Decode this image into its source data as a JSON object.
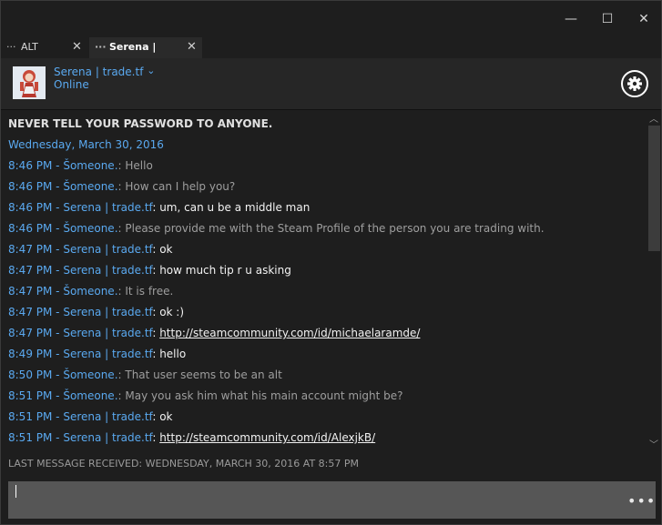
{
  "window": {
    "minimize_glyph": "—",
    "maximize_glyph": "☐",
    "close_glyph": "✕"
  },
  "tabs": [
    {
      "label": "ALT",
      "active": false,
      "close": "✕",
      "dots": "···"
    },
    {
      "label": "Serena | trade.tf",
      "active": true,
      "close": "✕",
      "dots": "···"
    }
  ],
  "header": {
    "name": "Serena | trade.tf",
    "chevron": "⌄",
    "status": "Online",
    "gear_icon": "gear-icon"
  },
  "chat": {
    "warning": "NEVER TELL YOUR PASSWORD TO ANYONE.",
    "date": "Wednesday, March 30, 2016",
    "messages": [
      {
        "time": "8:46 PM",
        "sender": "Šomeone.",
        "text": "Hello",
        "kind": "them"
      },
      {
        "time": "8:46 PM",
        "sender": "Šomeone.",
        "text": "How can I help you?",
        "kind": "them"
      },
      {
        "time": "8:46 PM",
        "sender": "Serena | trade.tf",
        "text": "um, can u be a middle man",
        "kind": "me"
      },
      {
        "time": "8:46 PM",
        "sender": "Šomeone.",
        "text": "Please provide me with the Steam Profile of the person you are trading with.",
        "kind": "them"
      },
      {
        "time": "8:47 PM",
        "sender": "Serena | trade.tf",
        "text": "ok",
        "kind": "me"
      },
      {
        "time": "8:47 PM",
        "sender": "Serena | trade.tf",
        "text": "how much tip r u asking",
        "kind": "me"
      },
      {
        "time": "8:47 PM",
        "sender": "Šomeone.",
        "text": "It is free.",
        "kind": "them"
      },
      {
        "time": "8:47 PM",
        "sender": "Serena | trade.tf",
        "text": "ok :)",
        "kind": "me"
      },
      {
        "time": "8:47 PM",
        "sender": "Serena | trade.tf",
        "text": "http://steamcommunity.com/id/michaelaramde/",
        "kind": "link"
      },
      {
        "time": "8:49 PM",
        "sender": "Serena | trade.tf",
        "text": "hello",
        "kind": "me"
      },
      {
        "time": "8:50 PM",
        "sender": "Šomeone.",
        "text": "That user seems to be an alt",
        "kind": "them"
      },
      {
        "time": "8:51 PM",
        "sender": "Šomeone.",
        "text": "May you ask him what his main account might be?",
        "kind": "them"
      },
      {
        "time": "8:51 PM",
        "sender": "Serena | trade.tf",
        "text": "ok",
        "kind": "me"
      },
      {
        "time": "8:51 PM",
        "sender": "Serena | trade.tf",
        "text": "http://steamcommunity.com/id/AlexjkB/",
        "kind": "link"
      }
    ]
  },
  "status_bar": "LAST MESSAGE RECEIVED: WEDNESDAY, MARCH 30, 2016 AT 8:57 PM",
  "composer": {
    "value": "",
    "more_glyph": "•••"
  },
  "scrollbar": {
    "up_glyph": "︿",
    "down_glyph": "﹀"
  },
  "colors": {
    "accent": "#5aa9f0",
    "background": "#1e1e1e",
    "header": "#262626",
    "composer": "#565656"
  }
}
